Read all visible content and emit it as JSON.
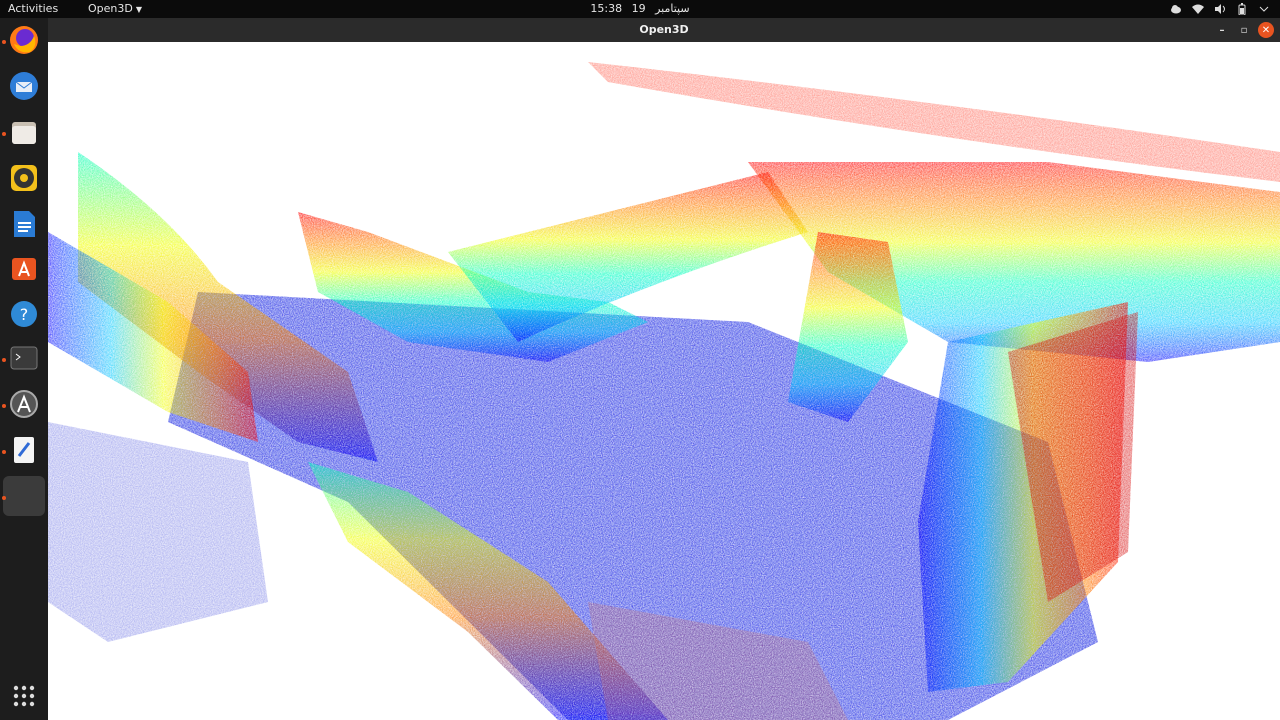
{
  "topbar": {
    "activities": "Activities",
    "app_menu": "Open3D",
    "time": "15:38",
    "date_day": "19",
    "date_month": "سپتامبر"
  },
  "window": {
    "title": "Open3D"
  },
  "dock": {
    "items": [
      {
        "icon": "firefox-icon",
        "running": true
      },
      {
        "icon": "thunderbird-icon",
        "running": false
      },
      {
        "icon": "files-icon",
        "running": true
      },
      {
        "icon": "rhythmbox-icon",
        "running": false
      },
      {
        "icon": "writer-icon",
        "running": false
      },
      {
        "icon": "software-icon",
        "running": false
      },
      {
        "icon": "help-icon",
        "running": false
      },
      {
        "icon": "terminal-icon",
        "running": true
      },
      {
        "icon": "updater-icon",
        "running": true
      },
      {
        "icon": "text-editor-icon",
        "running": true
      },
      {
        "icon": "open3d-window-icon",
        "running": true
      }
    ],
    "show_apps": "show-applications-icon"
  },
  "colors": {
    "accent": "#e95420",
    "viewport_bg": "#ffffff",
    "colormap": [
      "#0000ff",
      "#00c8ff",
      "#00ffc0",
      "#f0ff00",
      "#ff8000",
      "#ff0000"
    ]
  }
}
